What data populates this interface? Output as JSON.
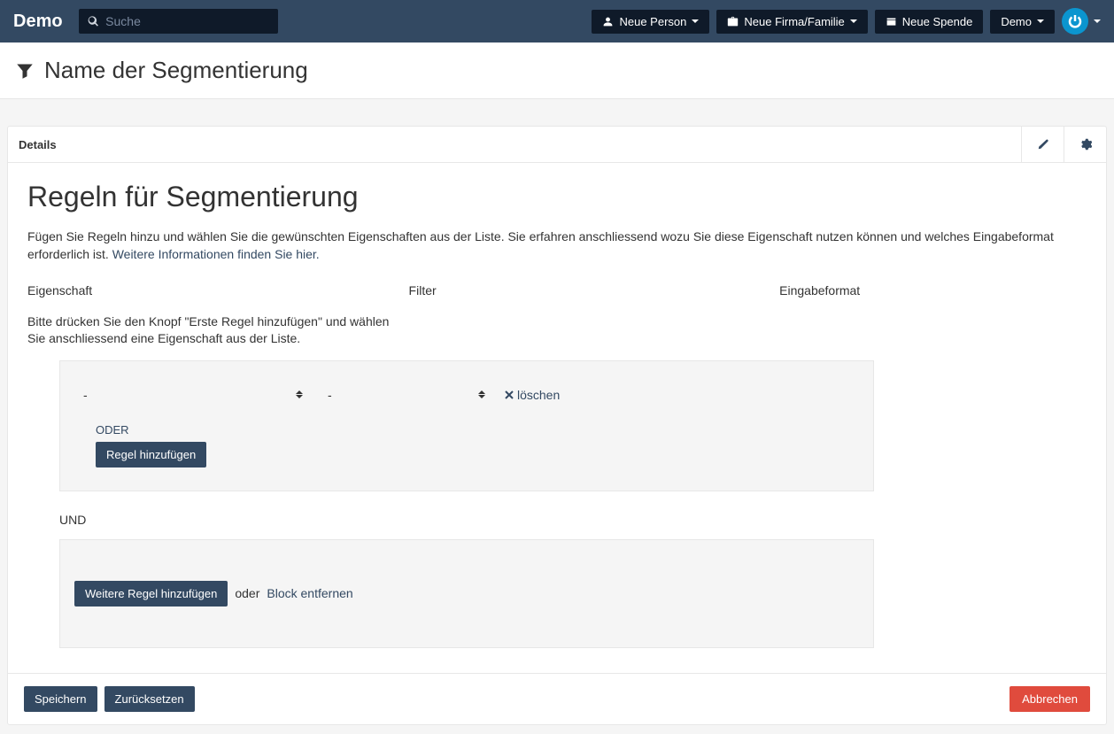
{
  "nav": {
    "brand": "Demo",
    "search_placeholder": "Suche",
    "newPerson": "Neue Person",
    "newCompany": "Neue Firma/Familie",
    "newDonation": "Neue Spende",
    "userMenu": "Demo"
  },
  "page": {
    "title": "Name der Segmentierung"
  },
  "card": {
    "tab": "Details",
    "heading": "Regeln für Segmentierung",
    "intro_text": "Fügen Sie Regeln hinzu und wählen Sie die gewünschten Eigenschaften aus der Liste. Sie erfahren anschliessend wozu Sie diese Eigenschaft nutzen können und welches Eingabeformat erforderlich ist. ",
    "intro_link": "Weitere Informationen finden Sie hier.",
    "col_property": "Eigenschaft",
    "col_filter": "Filter",
    "col_format": "Eingabeformat",
    "hint": "Bitte drücken Sie den Knopf \"Erste Regel hinzufügen\" und wählen Sie anschliessend eine Eigenschaft aus der Liste.",
    "select_placeholder": "-",
    "delete": "löschen",
    "or_label": "ODER",
    "add_rule": "Regel hinzufügen",
    "and_label": "UND",
    "add_more_rule": "Weitere Regel hinzufügen",
    "or_word": "oder",
    "remove_block": "Block entfernen"
  },
  "footer": {
    "save": "Speichern",
    "reset": "Zurücksetzen",
    "cancel": "Abbrechen"
  }
}
